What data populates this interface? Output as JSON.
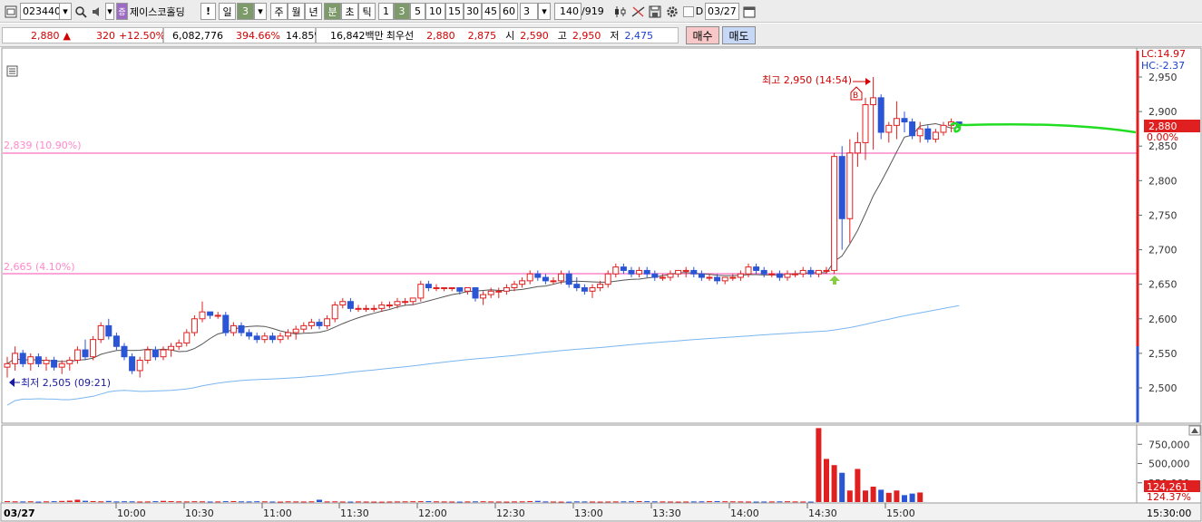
{
  "toolbar": {
    "code": "023440",
    "stock_name": "제이스코홀딩",
    "exclaim": "!",
    "period_day": "일",
    "period_day_n": "3",
    "period_week": "주",
    "period_month": "월",
    "period_year": "년",
    "period_min": "분",
    "period_sec": "초",
    "period_tick": "틱",
    "intervals": [
      "1",
      "3",
      "5",
      "10",
      "15",
      "30",
      "45",
      "60"
    ],
    "interval_selected": "3",
    "interval_input": "3",
    "count": "140",
    "total": "/919",
    "d_label": "D",
    "date": "03/27"
  },
  "quote": {
    "price": "2,880",
    "arrow": "▲",
    "change": "320",
    "change_pct": "+12.50%",
    "volume": "6,082,776",
    "volume_ratio": "394.66%",
    "turnover": "14.85%",
    "amount": "16,842백만",
    "best_label": "최우선",
    "ask": "2,880",
    "bid": "2,875",
    "open_label": "시",
    "open": "2,590",
    "high_label": "고",
    "high": "2,950",
    "low_label": "저",
    "low": "2,475",
    "buy": "매수",
    "sell": "매도"
  },
  "chart": {
    "lc": "LC:14.97",
    "hc": "HC:-2.37",
    "high_marker": "최고 2,950 (14:54)",
    "low_marker": "최저 2,505 (09:21)",
    "line1_label": "2,839 (10.90%)",
    "line2_label": "2,665 (4.10%)",
    "b_marker": "B",
    "last_price": "2,880",
    "last_pct": "0.00%",
    "last_volume": "124,261",
    "last_volume_pct": "124.37%",
    "date_label": "03/27",
    "end_time": "15:30:00",
    "colors": {
      "up": "#e02020",
      "down": "#2a55d4",
      "band": "#ff88cc",
      "ma": "#7ab6f0"
    }
  },
  "chart_data": {
    "type": "candlestick",
    "price_axis": {
      "ticks": [
        "2,950",
        "2,900",
        "2,850",
        "2,800",
        "2,750",
        "2,700",
        "2,650",
        "2,600",
        "2,550",
        "2,500"
      ],
      "range": [
        2455,
        2985
      ]
    },
    "volume_axis": {
      "ticks": [
        "750,000",
        "500,000",
        "250,000"
      ],
      "range": [
        0,
        1000000
      ]
    },
    "time_axis": [
      "10:00",
      "10:30",
      "11:00",
      "11:30",
      "12:00",
      "12:30",
      "13:00",
      "13:30",
      "14:00",
      "14:30",
      "15:00"
    ],
    "candles": [
      [
        2530,
        2545,
        2515,
        2535
      ],
      [
        2535,
        2560,
        2525,
        2550
      ],
      [
        2550,
        2555,
        2530,
        2535
      ],
      [
        2535,
        2550,
        2525,
        2545
      ],
      [
        2545,
        2550,
        2530,
        2535
      ],
      [
        2535,
        2545,
        2525,
        2540
      ],
      [
        2540,
        2545,
        2525,
        2530
      ],
      [
        2530,
        2540,
        2520,
        2535
      ],
      [
        2535,
        2545,
        2525,
        2540
      ],
      [
        2540,
        2560,
        2535,
        2555
      ],
      [
        2555,
        2570,
        2540,
        2545
      ],
      [
        2545,
        2575,
        2540,
        2570
      ],
      [
        2570,
        2595,
        2565,
        2590
      ],
      [
        2590,
        2600,
        2570,
        2575
      ],
      [
        2575,
        2580,
        2555,
        2560
      ],
      [
        2560,
        2565,
        2540,
        2545
      ],
      [
        2545,
        2550,
        2520,
        2525
      ],
      [
        2525,
        2545,
        2515,
        2540
      ],
      [
        2540,
        2560,
        2535,
        2555
      ],
      [
        2555,
        2560,
        2540,
        2545
      ],
      [
        2545,
        2560,
        2540,
        2555
      ],
      [
        2555,
        2565,
        2545,
        2560
      ],
      [
        2560,
        2570,
        2555,
        2565
      ],
      [
        2565,
        2585,
        2560,
        2580
      ],
      [
        2580,
        2605,
        2575,
        2600
      ],
      [
        2600,
        2625,
        2595,
        2610
      ],
      [
        2610,
        2610,
        2600,
        2605
      ],
      [
        2605,
        2610,
        2600,
        2605
      ],
      [
        2605,
        2610,
        2575,
        2580
      ],
      [
        2580,
        2595,
        2575,
        2590
      ],
      [
        2590,
        2595,
        2575,
        2580
      ],
      [
        2580,
        2585,
        2570,
        2575
      ],
      [
        2575,
        2580,
        2565,
        2570
      ],
      [
        2570,
        2580,
        2565,
        2575
      ],
      [
        2575,
        2580,
        2565,
        2570
      ],
      [
        2570,
        2580,
        2565,
        2575
      ],
      [
        2575,
        2585,
        2570,
        2580
      ],
      [
        2580,
        2590,
        2570,
        2585
      ],
      [
        2585,
        2595,
        2580,
        2590
      ],
      [
        2590,
        2600,
        2585,
        2595
      ],
      [
        2595,
        2600,
        2585,
        2590
      ],
      [
        2590,
        2605,
        2585,
        2600
      ],
      [
        2600,
        2625,
        2595,
        2620
      ],
      [
        2620,
        2630,
        2615,
        2625
      ],
      [
        2625,
        2630,
        2610,
        2615
      ],
      [
        2615,
        2620,
        2610,
        2615
      ],
      [
        2615,
        2620,
        2610,
        2615
      ],
      [
        2615,
        2620,
        2610,
        2615
      ],
      [
        2615,
        2625,
        2610,
        2620
      ],
      [
        2620,
        2625,
        2615,
        2620
      ],
      [
        2620,
        2630,
        2615,
        2625
      ],
      [
        2625,
        2630,
        2620,
        2625
      ],
      [
        2625,
        2630,
        2620,
        2630
      ],
      [
        2630,
        2655,
        2625,
        2650
      ],
      [
        2650,
        2655,
        2640,
        2645
      ],
      [
        2645,
        2650,
        2640,
        2645
      ],
      [
        2645,
        2645,
        2640,
        2645
      ],
      [
        2645,
        2645,
        2640,
        2645
      ],
      [
        2645,
        2645,
        2635,
        2640
      ],
      [
        2640,
        2645,
        2635,
        2645
      ],
      [
        2645,
        2645,
        2625,
        2630
      ],
      [
        2630,
        2640,
        2620,
        2635
      ],
      [
        2635,
        2645,
        2630,
        2640
      ],
      [
        2640,
        2645,
        2630,
        2640
      ],
      [
        2640,
        2650,
        2635,
        2645
      ],
      [
        2645,
        2655,
        2640,
        2650
      ],
      [
        2650,
        2660,
        2645,
        2655
      ],
      [
        2655,
        2670,
        2650,
        2665
      ],
      [
        2665,
        2670,
        2655,
        2660
      ],
      [
        2660,
        2665,
        2650,
        2655
      ],
      [
        2655,
        2660,
        2650,
        2655
      ],
      [
        2655,
        2670,
        2650,
        2665
      ],
      [
        2665,
        2670,
        2645,
        2650
      ],
      [
        2650,
        2660,
        2640,
        2645
      ],
      [
        2645,
        2650,
        2635,
        2640
      ],
      [
        2640,
        2650,
        2630,
        2645
      ],
      [
        2645,
        2655,
        2640,
        2650
      ],
      [
        2650,
        2670,
        2645,
        2665
      ],
      [
        2665,
        2680,
        2660,
        2675
      ],
      [
        2675,
        2680,
        2665,
        2670
      ],
      [
        2670,
        2675,
        2660,
        2665
      ],
      [
        2665,
        2675,
        2660,
        2670
      ],
      [
        2670,
        2675,
        2660,
        2665
      ],
      [
        2665,
        2670,
        2655,
        2660
      ],
      [
        2660,
        2665,
        2655,
        2660
      ],
      [
        2660,
        2670,
        2655,
        2665
      ],
      [
        2665,
        2670,
        2660,
        2670
      ],
      [
        2670,
        2675,
        2660,
        2670
      ],
      [
        2670,
        2675,
        2660,
        2665
      ],
      [
        2665,
        2670,
        2655,
        2660
      ],
      [
        2660,
        2665,
        2655,
        2660
      ],
      [
        2660,
        2665,
        2650,
        2655
      ],
      [
        2655,
        2660,
        2650,
        2660
      ],
      [
        2660,
        2665,
        2655,
        2660
      ],
      [
        2660,
        2670,
        2655,
        2665
      ],
      [
        2665,
        2680,
        2660,
        2675
      ],
      [
        2675,
        2680,
        2665,
        2670
      ],
      [
        2670,
        2675,
        2660,
        2665
      ],
      [
        2665,
        2670,
        2660,
        2665
      ],
      [
        2665,
        2670,
        2655,
        2660
      ],
      [
        2660,
        2670,
        2655,
        2665
      ],
      [
        2665,
        2670,
        2660,
        2665
      ],
      [
        2665,
        2675,
        2660,
        2670
      ],
      [
        2670,
        2675,
        2660,
        2665
      ],
      [
        2665,
        2670,
        2660,
        2670
      ],
      [
        2670,
        2675,
        2665,
        2670
      ],
      [
        2670,
        2840,
        2665,
        2835
      ],
      [
        2835,
        2850,
        2700,
        2745
      ],
      [
        2745,
        2860,
        2710,
        2840
      ],
      [
        2840,
        2870,
        2820,
        2855
      ],
      [
        2855,
        2920,
        2830,
        2910
      ],
      [
        2910,
        2950,
        2845,
        2920
      ],
      [
        2920,
        2925,
        2860,
        2870
      ],
      [
        2870,
        2885,
        2855,
        2880
      ],
      [
        2880,
        2915,
        2860,
        2890
      ],
      [
        2890,
        2900,
        2870,
        2885
      ],
      [
        2885,
        2890,
        2860,
        2865
      ],
      [
        2865,
        2885,
        2855,
        2875
      ],
      [
        2875,
        2880,
        2855,
        2860
      ],
      [
        2860,
        2875,
        2855,
        2870
      ],
      [
        2870,
        2885,
        2865,
        2880
      ],
      [
        2880,
        2890,
        2870,
        2885
      ],
      [
        2885,
        2885,
        2875,
        2880
      ]
    ],
    "volumes": [
      12000,
      9000,
      8000,
      10000,
      6000,
      9000,
      11000,
      14000,
      18000,
      30000,
      16000,
      12000,
      9000,
      14000,
      8000,
      10000,
      9000,
      7000,
      8000,
      11000,
      15000,
      12000,
      9000,
      8000,
      10000,
      9000,
      7000,
      8000,
      11000,
      12000,
      9000,
      8000,
      10000,
      9000,
      7000,
      6000,
      9000,
      8000,
      7000,
      9000,
      30000,
      8000,
      9000,
      7000,
      6000,
      8000,
      7000,
      6000,
      5000,
      7000,
      8000,
      9000,
      10000,
      11000,
      12000,
      9000,
      8000,
      7000,
      6000,
      8000,
      9000,
      10000,
      8000,
      7000,
      6000,
      8000,
      9000,
      12000,
      15000,
      8000,
      7000,
      6000,
      5000,
      9000,
      8000,
      7000,
      6000,
      7000,
      8000,
      9000,
      10000,
      12000,
      11000,
      9000,
      8000,
      7000,
      6000,
      7000,
      8000,
      9000,
      11000,
      12000,
      10000,
      9000,
      8000,
      7000,
      6000,
      7000,
      8000,
      9000,
      10000,
      8000,
      7000,
      6000,
      960000,
      560000,
      480000,
      380000,
      150000,
      430000,
      150000,
      200000,
      160000,
      120000,
      150000,
      90000,
      110000,
      124261
    ],
    "upper_band_price": 2839,
    "lower_band_price": 2665
  }
}
